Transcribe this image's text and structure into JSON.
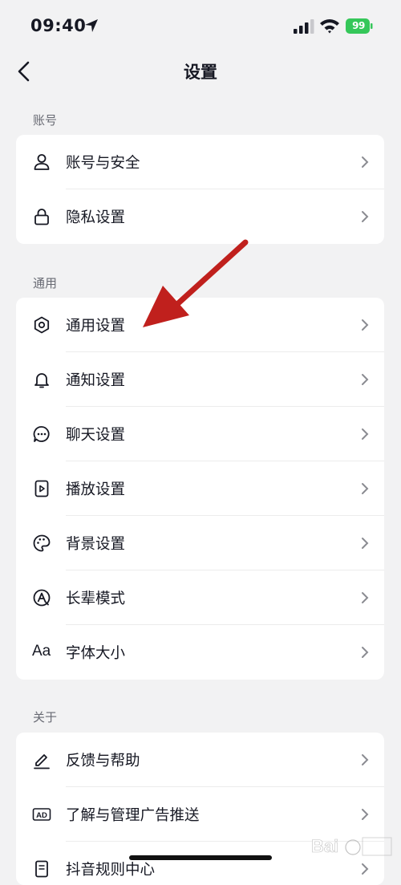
{
  "status_bar": {
    "time": "09:40",
    "battery": "99"
  },
  "nav": {
    "title": "设置"
  },
  "sections": [
    {
      "label": "账号",
      "items": [
        {
          "label": "账号与安全",
          "icon": "person-icon"
        },
        {
          "label": "隐私设置",
          "icon": "lock-icon"
        }
      ]
    },
    {
      "label": "通用",
      "items": [
        {
          "label": "通用设置",
          "icon": "gear-icon"
        },
        {
          "label": "通知设置",
          "icon": "bell-icon"
        },
        {
          "label": "聊天设置",
          "icon": "chat-bubble-icon"
        },
        {
          "label": "播放设置",
          "icon": "play-icon"
        },
        {
          "label": "背景设置",
          "icon": "palette-icon"
        },
        {
          "label": "长辈模式",
          "icon": "elder-mode-icon"
        },
        {
          "label": "字体大小",
          "icon": "font-size-icon",
          "icon_text": "Aa"
        }
      ]
    },
    {
      "label": "关于",
      "items": [
        {
          "label": "反馈与帮助",
          "icon": "pen-icon"
        },
        {
          "label": "了解与管理广告推送",
          "icon": "ad-icon",
          "icon_text": "AD"
        },
        {
          "label": "抖音规则中心",
          "icon": "document-icon"
        }
      ]
    }
  ],
  "annotation": {
    "type": "arrow",
    "color": "#c0201d"
  }
}
